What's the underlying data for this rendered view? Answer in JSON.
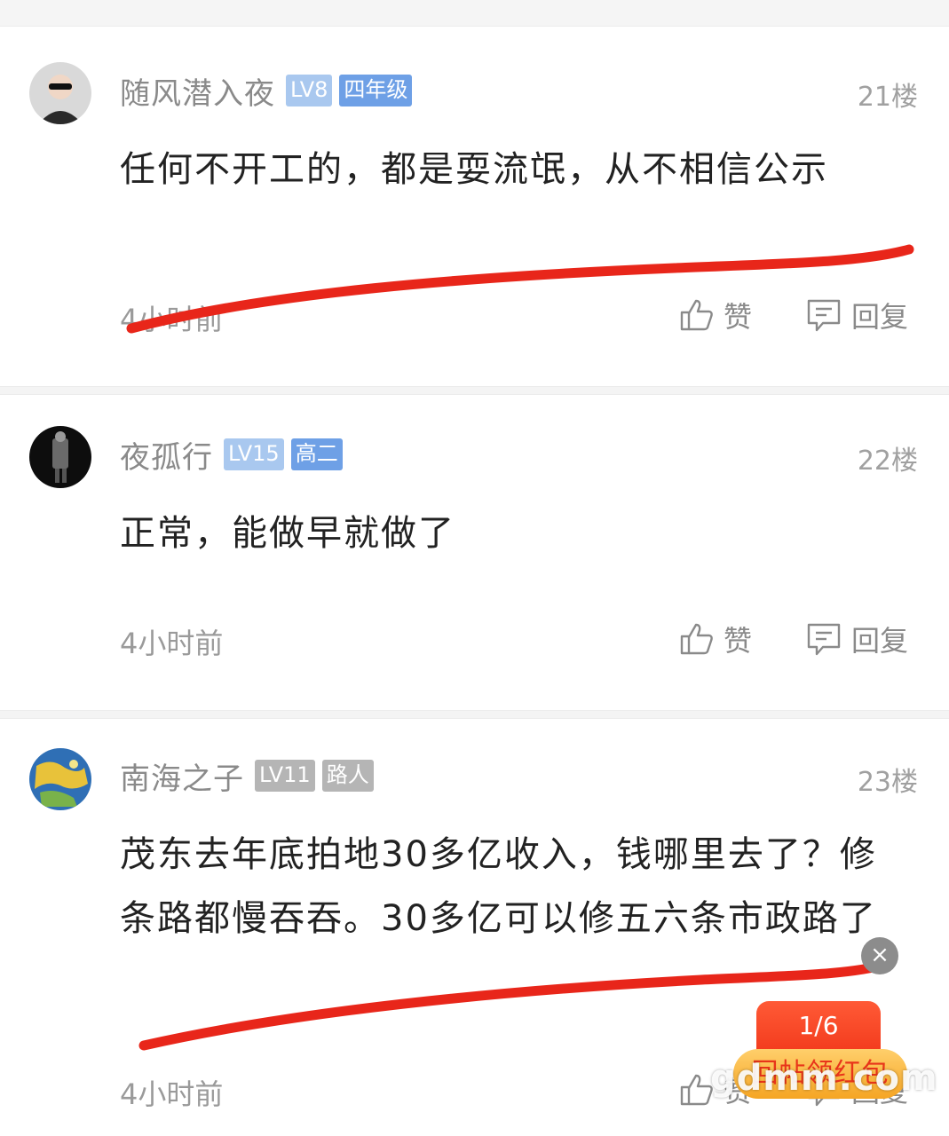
{
  "comments": [
    {
      "username": "随风潜入夜",
      "level": "LV8",
      "grade": "四年级",
      "floor": "21楼",
      "content": "任何不开工的，都是耍流氓，从不相信公示",
      "time": "4小时前",
      "like_label": "赞",
      "reply_label": "回复"
    },
    {
      "username": "夜孤行",
      "level": "LV15",
      "grade": "高二",
      "floor": "22楼",
      "content": "正常，能做早就做了",
      "time": "4小时前",
      "like_label": "赞",
      "reply_label": "回复"
    },
    {
      "username": "南海之子",
      "level": "LV11",
      "grade": "路人",
      "floor": "23楼",
      "content": "茂东去年底拍地30多亿收入，钱哪里去了？修条路都慢吞吞。30多亿可以修五六条市政路了",
      "time": "4小时前",
      "like_label": "赞",
      "reply_label": "回复"
    }
  ],
  "red_packet": {
    "counter": "1/6",
    "banner": "回帖领红包"
  },
  "watermark": "gdmm.com",
  "colors": {
    "annotation_red": "#e8261a",
    "badge_level": "#a9c8ef",
    "badge_grade": "#6ea0e6",
    "badge_gray": "#b5b5b5"
  }
}
